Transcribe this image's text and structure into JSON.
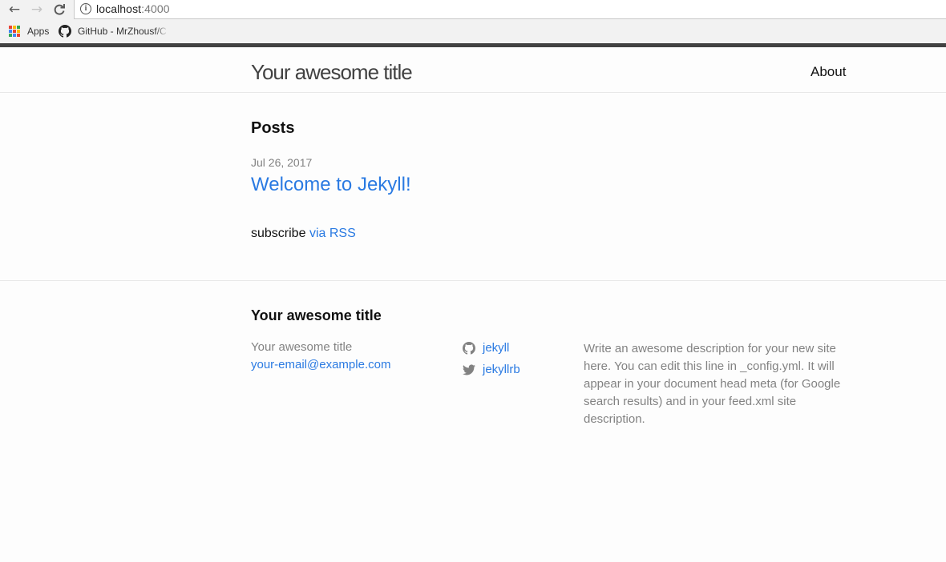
{
  "browser": {
    "url_host": "localhost",
    "url_port": ":4000",
    "bookmarks": [
      {
        "label": "Apps",
        "icon": "apps-grid-icon"
      },
      {
        "label": "GitHub - MrZhousf/C",
        "icon": "github-icon"
      }
    ]
  },
  "header": {
    "site_title": "Your awesome title",
    "nav": [
      {
        "label": "About"
      }
    ]
  },
  "main": {
    "heading": "Posts",
    "posts": [
      {
        "date": "Jul 26, 2017",
        "title": "Welcome to Jekyll!"
      }
    ],
    "subscribe_text": "subscribe",
    "rss_link": "via RSS"
  },
  "footer": {
    "heading": "Your awesome title",
    "name": "Your awesome title",
    "email": "your-email@example.com",
    "social": [
      {
        "icon": "github-icon",
        "username": "jekyll"
      },
      {
        "icon": "twitter-icon",
        "username": "jekyllrb"
      }
    ],
    "description": "Write an awesome description for your new site here. You can edit this line in _config.yml. It will appear in your document head meta (for Google search results) and in your feed.xml site description."
  },
  "colors": {
    "link": "#2a7ae2",
    "text": "#111111",
    "muted": "#828282",
    "header_border": "#424242"
  }
}
